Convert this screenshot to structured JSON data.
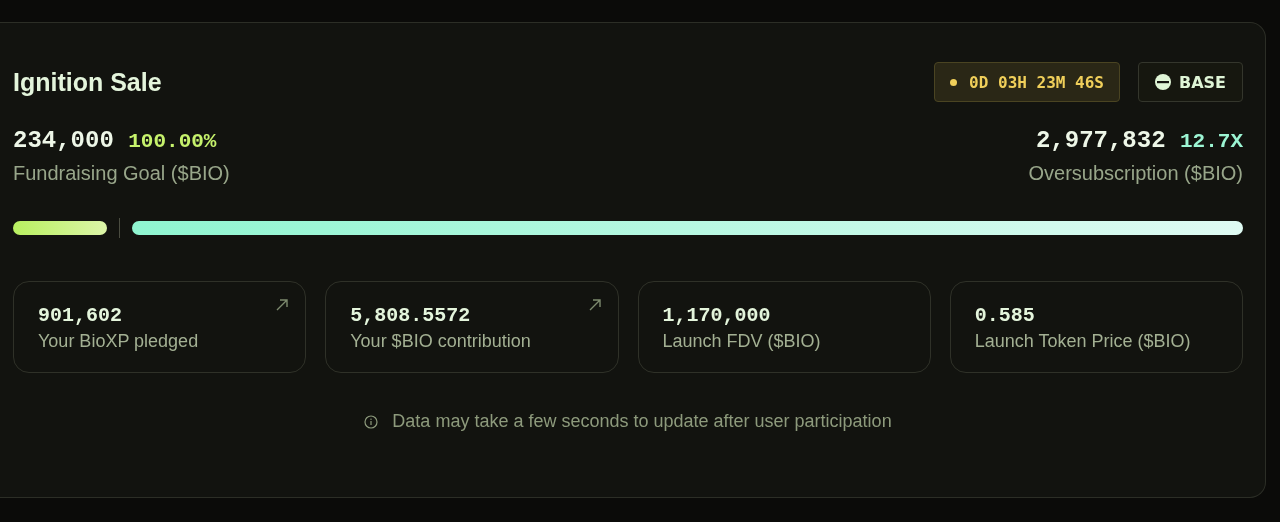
{
  "title": "Ignition Sale",
  "countdown": "0D 03H 23M 46S",
  "network": "BASE",
  "goal": {
    "amount": "234,000",
    "percent": "100.00%",
    "label": "Fundraising Goal ($BIO)"
  },
  "oversubscription": {
    "amount": "2,977,832",
    "multiple": "12.7X",
    "label": "Oversubscription ($BIO)"
  },
  "stats": [
    {
      "value": "901,602",
      "label": "Your BioXP pledged",
      "linked": true
    },
    {
      "value": "5,808.5572",
      "label": "Your $BIO contribution",
      "linked": true
    },
    {
      "value": "1,170,000",
      "label": "Launch FDV ($BIO)",
      "linked": false
    },
    {
      "value": "0.585",
      "label": "Launch Token Price ($BIO)",
      "linked": false
    }
  ],
  "note": "Data may take a few seconds to update after user participation"
}
